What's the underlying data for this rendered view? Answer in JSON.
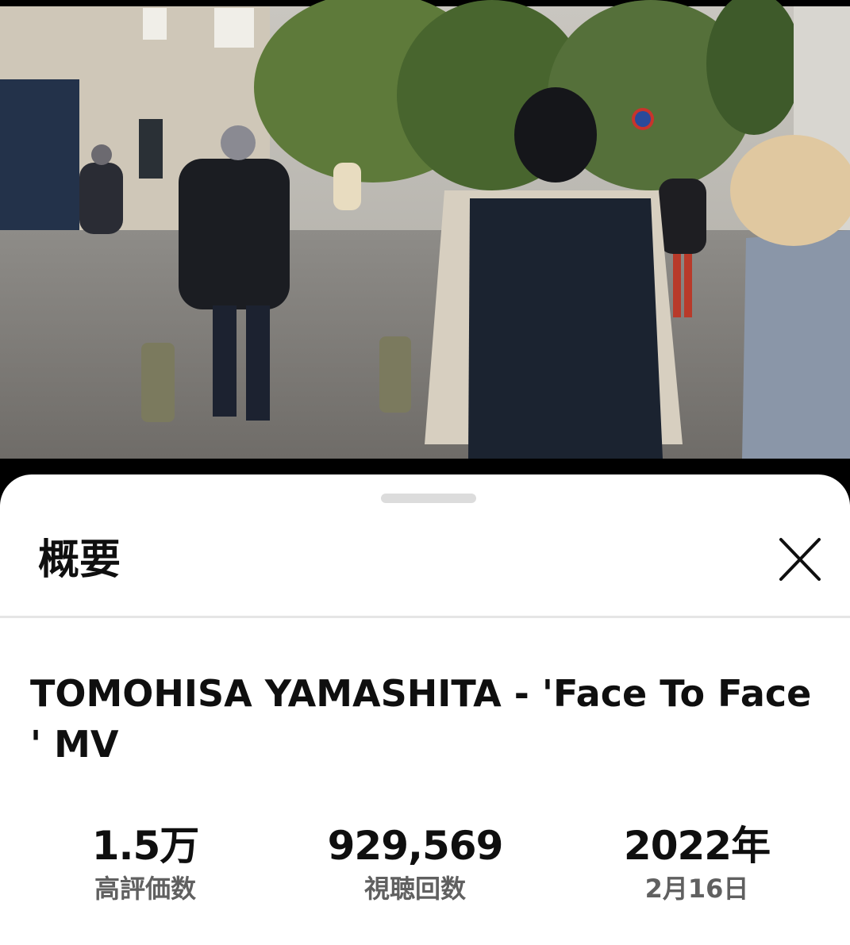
{
  "sheet": {
    "title": "概要",
    "close_icon": "close-icon"
  },
  "video": {
    "title": "TOMOHISA YAMASHITA - 'Face To Face ' MV"
  },
  "stats": [
    {
      "value": "1.5万",
      "label": "高評価数"
    },
    {
      "value": "929,569",
      "label": "視聴回数"
    },
    {
      "value": "2022年",
      "label": "2月16日"
    }
  ]
}
